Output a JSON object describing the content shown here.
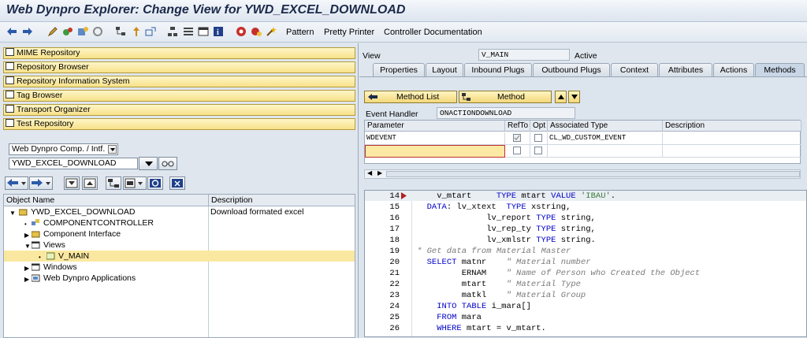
{
  "title": "Web Dynpro Explorer: Change View for YWD_EXCEL_DOWNLOAD",
  "toolbar": {
    "pattern": "Pattern",
    "pretty_printer": "Pretty Printer",
    "controller_doc": "Controller Documentation"
  },
  "nav": {
    "mime": "MIME Repository",
    "repo_browser": "Repository Browser",
    "repo_info": "Repository Information System",
    "tag_browser": "Tag Browser",
    "transport": "Transport Organizer",
    "test_repo": "Test Repository"
  },
  "object_type": "Web Dynpro Comp. / Intf.",
  "object_name": "YWD_EXCEL_DOWNLOAD",
  "tree": {
    "col_object": "Object Name",
    "col_desc": "Description",
    "rows": [
      {
        "name": "YWD_EXCEL_DOWNLOAD",
        "desc": "Download formated excel"
      },
      {
        "name": "COMPONENTCONTROLLER",
        "desc": ""
      },
      {
        "name": "Component Interface",
        "desc": ""
      },
      {
        "name": "Views",
        "desc": ""
      },
      {
        "name": "V_MAIN",
        "desc": ""
      },
      {
        "name": "Windows",
        "desc": ""
      },
      {
        "name": "Web Dynpro Applications",
        "desc": ""
      }
    ]
  },
  "view": {
    "label": "View",
    "value": "V_MAIN",
    "status": "Active"
  },
  "tabs": [
    "Properties",
    "Layout",
    "Inbound Plugs",
    "Outbound Plugs",
    "Context",
    "Attributes",
    "Actions",
    "Methods"
  ],
  "methods": {
    "method_list": "Method List",
    "method": "Method",
    "event_handler_label": "Event Handler",
    "event_handler_value": "ONACTIONDOWNLOAD"
  },
  "param_table": {
    "headers": [
      "Parameter",
      "RefTo",
      "Opt",
      "Associated Type",
      "Description"
    ],
    "rows": [
      {
        "param": "WDEVENT",
        "refto": true,
        "opt": false,
        "type": "CL_WD_CUSTOM_EVENT",
        "desc": ""
      },
      {
        "param": "",
        "refto": false,
        "opt": false,
        "type": "",
        "desc": ""
      }
    ]
  },
  "code": [
    {
      "n": "14",
      "t": "    v_mtart     TYPE mtart VALUE 'IBAU'."
    },
    {
      "n": "15",
      "t": "  DATA: lv_xtext  TYPE xstring,"
    },
    {
      "n": "16",
      "t": "              lv_report TYPE string,"
    },
    {
      "n": "17",
      "t": "              lv_rep_ty TYPE string,"
    },
    {
      "n": "18",
      "t": "              lv_xmlstr TYPE string."
    },
    {
      "n": "19",
      "t": "* Get data from Material Master"
    },
    {
      "n": "20",
      "t": "  SELECT matnr    \" Material number"
    },
    {
      "n": "21",
      "t": "         ERNAM    \" Name of Person who Created the Object"
    },
    {
      "n": "22",
      "t": "         mtart    \" Material Type"
    },
    {
      "n": "23",
      "t": "         matkl    \" Material Group"
    },
    {
      "n": "24",
      "t": "    INTO TABLE i_mara[]"
    },
    {
      "n": "25",
      "t": "    FROM mara"
    },
    {
      "n": "26",
      "t": "    WHERE mtart = v_mtart."
    }
  ]
}
